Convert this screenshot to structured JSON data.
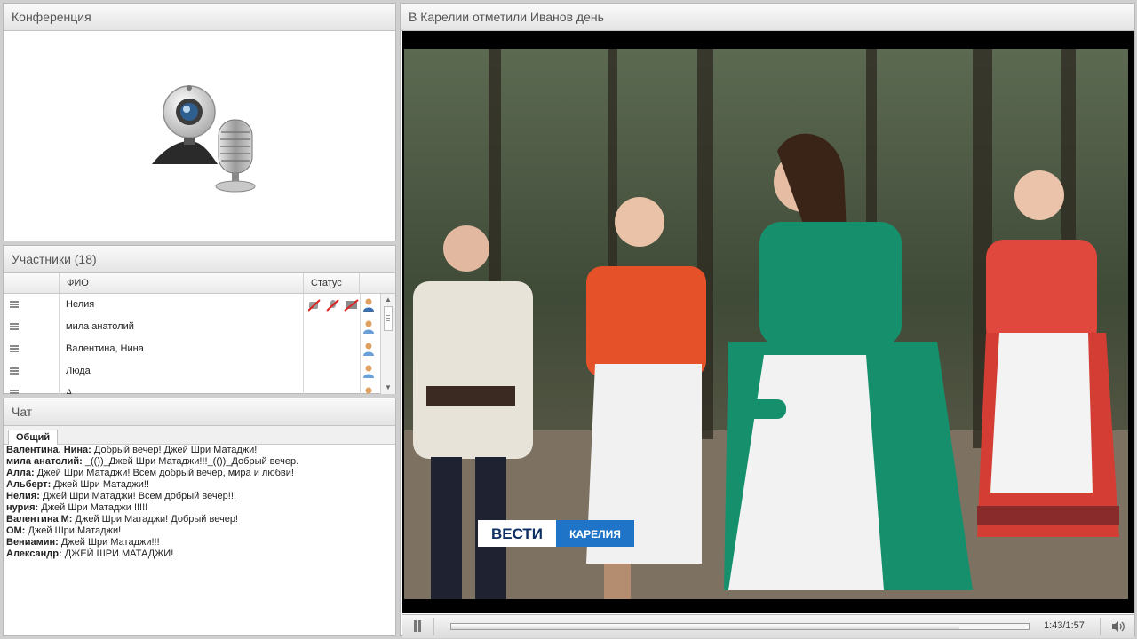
{
  "conference": {
    "title": "Конференция",
    "icon": "webcam-microphone-icon"
  },
  "participants": {
    "title": "Участники (18)",
    "columns": {
      "name": "ФИО",
      "status": "Статус"
    },
    "rows": [
      {
        "name": "Нелия",
        "status_icons": [
          "camera-off-icon",
          "mic-off-icon",
          "screen-off-icon"
        ],
        "role_icon": "user-icon"
      },
      {
        "name": "мила анатолий",
        "status_icons": [],
        "role_icon": "user-icon"
      },
      {
        "name": "Валентина, Нина",
        "status_icons": [],
        "role_icon": "user-icon"
      },
      {
        "name": "Люда",
        "status_icons": [],
        "role_icon": "user-icon"
      },
      {
        "name": "А",
        "status_icons": [],
        "role_icon": "user-icon"
      }
    ]
  },
  "chat": {
    "title": "Чат",
    "tab": "Общий",
    "messages": [
      {
        "author": "Валентина, Нина:",
        "text": " Добрый вечер! Джей Шри Матаджи!"
      },
      {
        "author": "мила анатолий:",
        "text": " _(())_Джей Шри Матаджи!!!_(())_Добрый вечер."
      },
      {
        "author": "Алла:",
        "text": " Джей Шри Матаджи! Всем добрый вечер, мира и любви!"
      },
      {
        "author": "Альберт:",
        "text": " Джей Шри Матаджи!!"
      },
      {
        "author": "Нелия:",
        "text": " Джей Шри Матаджи! Всем добрый вечер!!!"
      },
      {
        "author": "нурия:",
        "text": " Джей Шри Матаджи !!!!!"
      },
      {
        "author": "Валентина  М:",
        "text": " Джей Шри Матаджи! Добрый вечер!"
      },
      {
        "author": "ОМ:",
        "text": "  Джей Шри Матаджи!"
      },
      {
        "author": "Вениамин:",
        "text": " Джей  Шри  Матаджи!!!"
      },
      {
        "author": "Александр:",
        "text": " ДЖЕЙ ШРИ МАТАДЖИ!"
      }
    ]
  },
  "video": {
    "title": "В Карелии отметили Иванов день",
    "logo_left": "ВЕСТИ",
    "logo_right": "КАРЕЛИЯ",
    "time": "1:43/1:57",
    "progress": 0.88,
    "play_state": "pause-icon",
    "volume_icon": "speaker-icon"
  }
}
